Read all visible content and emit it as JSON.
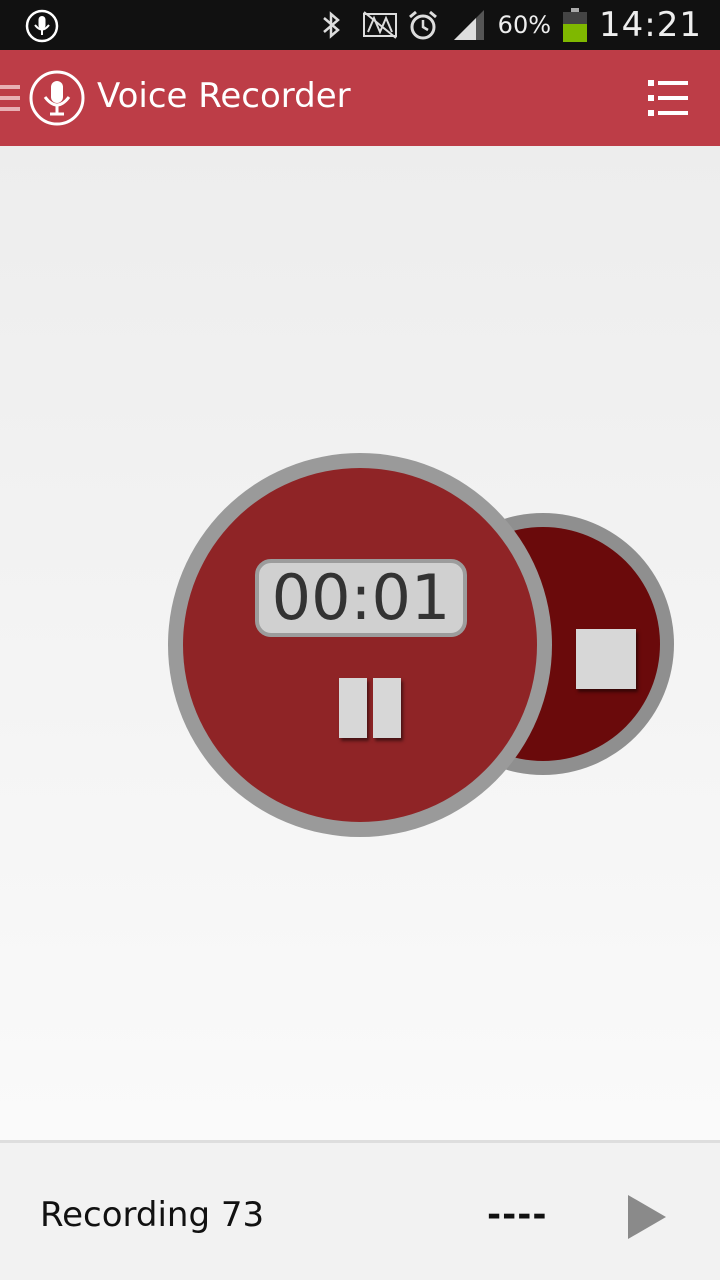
{
  "status_bar": {
    "battery_text": "60%",
    "time": "14:21",
    "icons": [
      "microphone-icon",
      "bluetooth-icon",
      "nfc-icon",
      "alarm-icon",
      "signal-icon",
      "battery-icon"
    ]
  },
  "app_bar": {
    "title": "Voice Recorder",
    "color": "#bd3d47"
  },
  "recorder": {
    "timer": "00:01",
    "record_color": "#8f2426",
    "stop_color": "#6a0a0b"
  },
  "bottom_bar": {
    "recording_name": "Recording 73",
    "duration": "----"
  }
}
